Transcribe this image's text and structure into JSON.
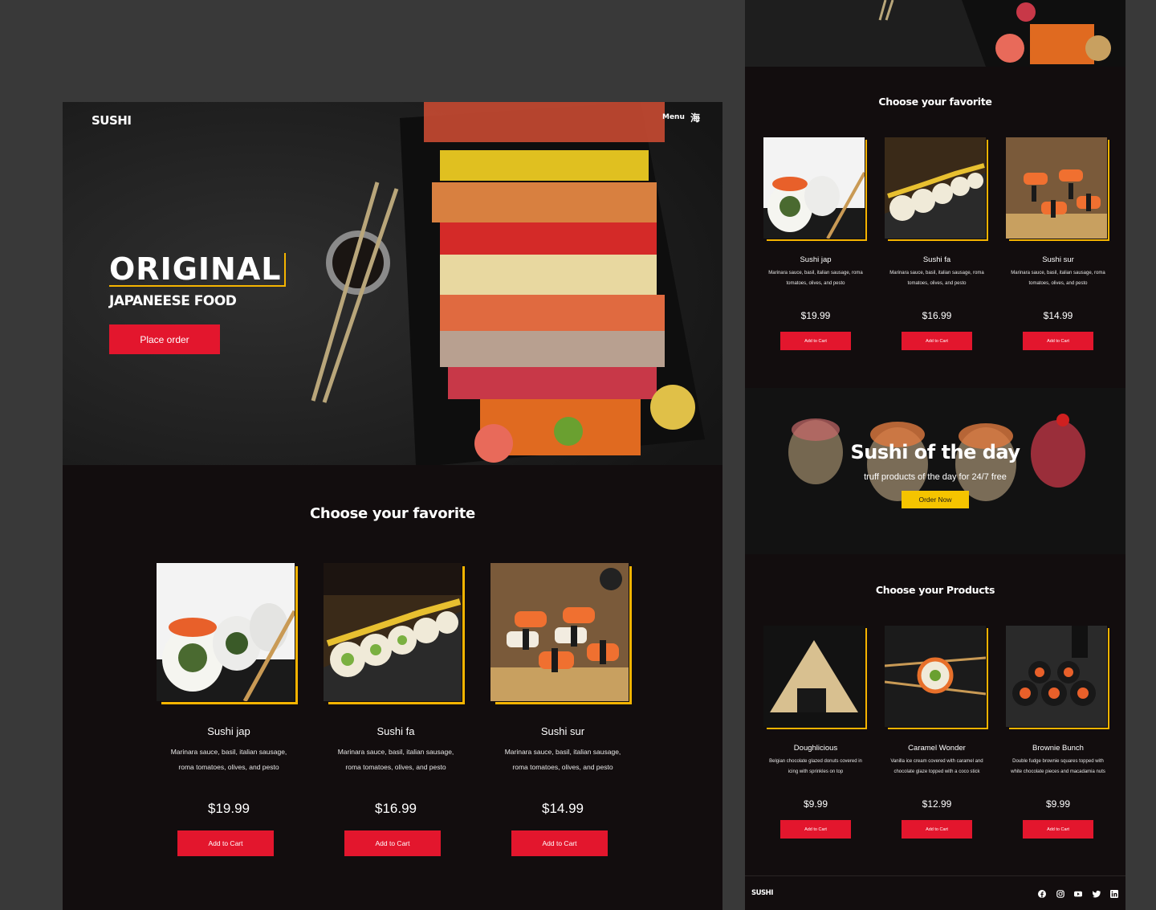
{
  "brand": "SUSHI",
  "hero": {
    "menu_label": "Menu",
    "menu_glyph": "海",
    "title": "ORIGINAL",
    "subtitle": "JAPANEESE FOOD",
    "cta": "Place order"
  },
  "favorites": {
    "title": "Choose your favorite",
    "items": [
      {
        "name": "Sushi jap",
        "desc": "Marinara sauce, basil, italian sausage, roma tomatoes, olives, and pesto",
        "price": "$19.99",
        "button": "Add to Cart"
      },
      {
        "name": "Sushi fa",
        "desc": "Marinara sauce, basil, italian sausage, roma tomatoes, olives, and pesto",
        "price": "$16.99",
        "button": "Add to Cart"
      },
      {
        "name": "Sushi sur",
        "desc": "Marinara sauce, basil, italian sausage, roma tomatoes, olives, and pesto",
        "price": "$14.99",
        "button": "Add to Cart"
      }
    ]
  },
  "sushi_of_the_day": {
    "title": "Sushi of the day",
    "subtitle": "truff products of the day for 24/7 free",
    "button": "Order Now"
  },
  "products": {
    "title": "Choose your Products",
    "items": [
      {
        "name": "Doughlicious",
        "desc": "Belgian chocolate glazed donuts covered in icing with sprinkles on top",
        "price": "$9.99",
        "button": "Add to Cart"
      },
      {
        "name": "Caramel Wonder",
        "desc": "Vanilla ice cream covered with caramel and chocolate glaze topped with a coco stick",
        "price": "$12.99",
        "button": "Add to Cart"
      },
      {
        "name": "Brownie Bunch",
        "desc": "Double fudge brownie squares topped with white chocolate pieces and macadamia nuts",
        "price": "$9.99",
        "button": "Add to Cart"
      }
    ]
  },
  "footer": {
    "brand": "SUSHI",
    "social": [
      "facebook-icon",
      "instagram-icon",
      "youtube-icon",
      "twitter-icon",
      "linkedin-icon"
    ]
  },
  "colors": {
    "accent_red": "#e3162d",
    "accent_yellow": "#f5b400",
    "page_bg": "#120d0e",
    "canvas_bg": "#393939"
  }
}
